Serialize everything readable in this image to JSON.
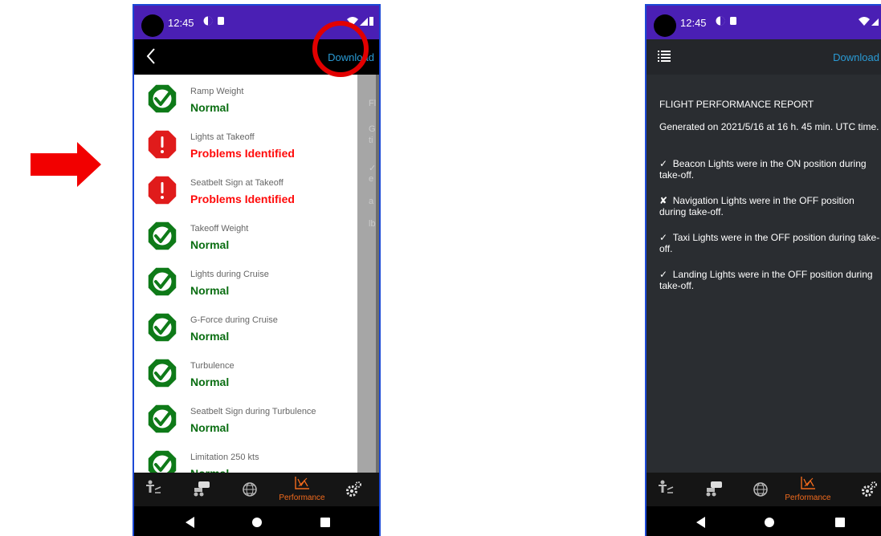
{
  "status_bar": {
    "time": "12:45"
  },
  "left_phone": {
    "download_label": "Download",
    "checks": [
      {
        "label": "Ramp Weight",
        "status": "Normal",
        "state": "ok"
      },
      {
        "label": "Lights at Takeoff",
        "status": "Problems Identified",
        "state": "problem"
      },
      {
        "label": "Seatbelt Sign at Takeoff",
        "status": "Problems Identified",
        "state": "problem"
      },
      {
        "label": "Takeoff Weight",
        "status": "Normal",
        "state": "ok"
      },
      {
        "label": "Lights during Cruise",
        "status": "Normal",
        "state": "ok"
      },
      {
        "label": "G-Force during Cruise",
        "status": "Normal",
        "state": "ok"
      },
      {
        "label": "Turbulence",
        "status": "Normal",
        "state": "ok"
      },
      {
        "label": "Seatbelt Sign during Turbulence",
        "status": "Normal",
        "state": "ok"
      },
      {
        "label": "Limitation 250 kts",
        "status": "Normal",
        "state": "ok"
      }
    ],
    "background_peek": [
      "Fl",
      "G",
      "ti",
      "✓",
      "e",
      "a",
      "lb"
    ]
  },
  "right_phone": {
    "download_label": "Download",
    "report_title": "FLIGHT PERFORMANCE REPORT",
    "generated": "Generated on 2021/5/16 at 16 h. 45 min. UTC time.",
    "lines": [
      {
        "mark": "✓",
        "text": "Beacon Lights were in the ON position during take-off."
      },
      {
        "mark": "✘",
        "text": "Navigation Lights were in the OFF position during take-off."
      },
      {
        "mark": "✓",
        "text": "Taxi Lights were in the OFF position during take-off."
      },
      {
        "mark": "✓",
        "text": "Landing Lights were in the OFF position during take-off."
      }
    ]
  },
  "tab_bar": {
    "active_label": "Performance"
  },
  "colors": {
    "status_bar": "#4a1fb4",
    "normal_green": "#0a6e12",
    "problem_red": "#ff0a0a",
    "accent_orange": "#f26b1d",
    "download_blue": "#2a9bd5",
    "highlight_red": "#e20000"
  }
}
